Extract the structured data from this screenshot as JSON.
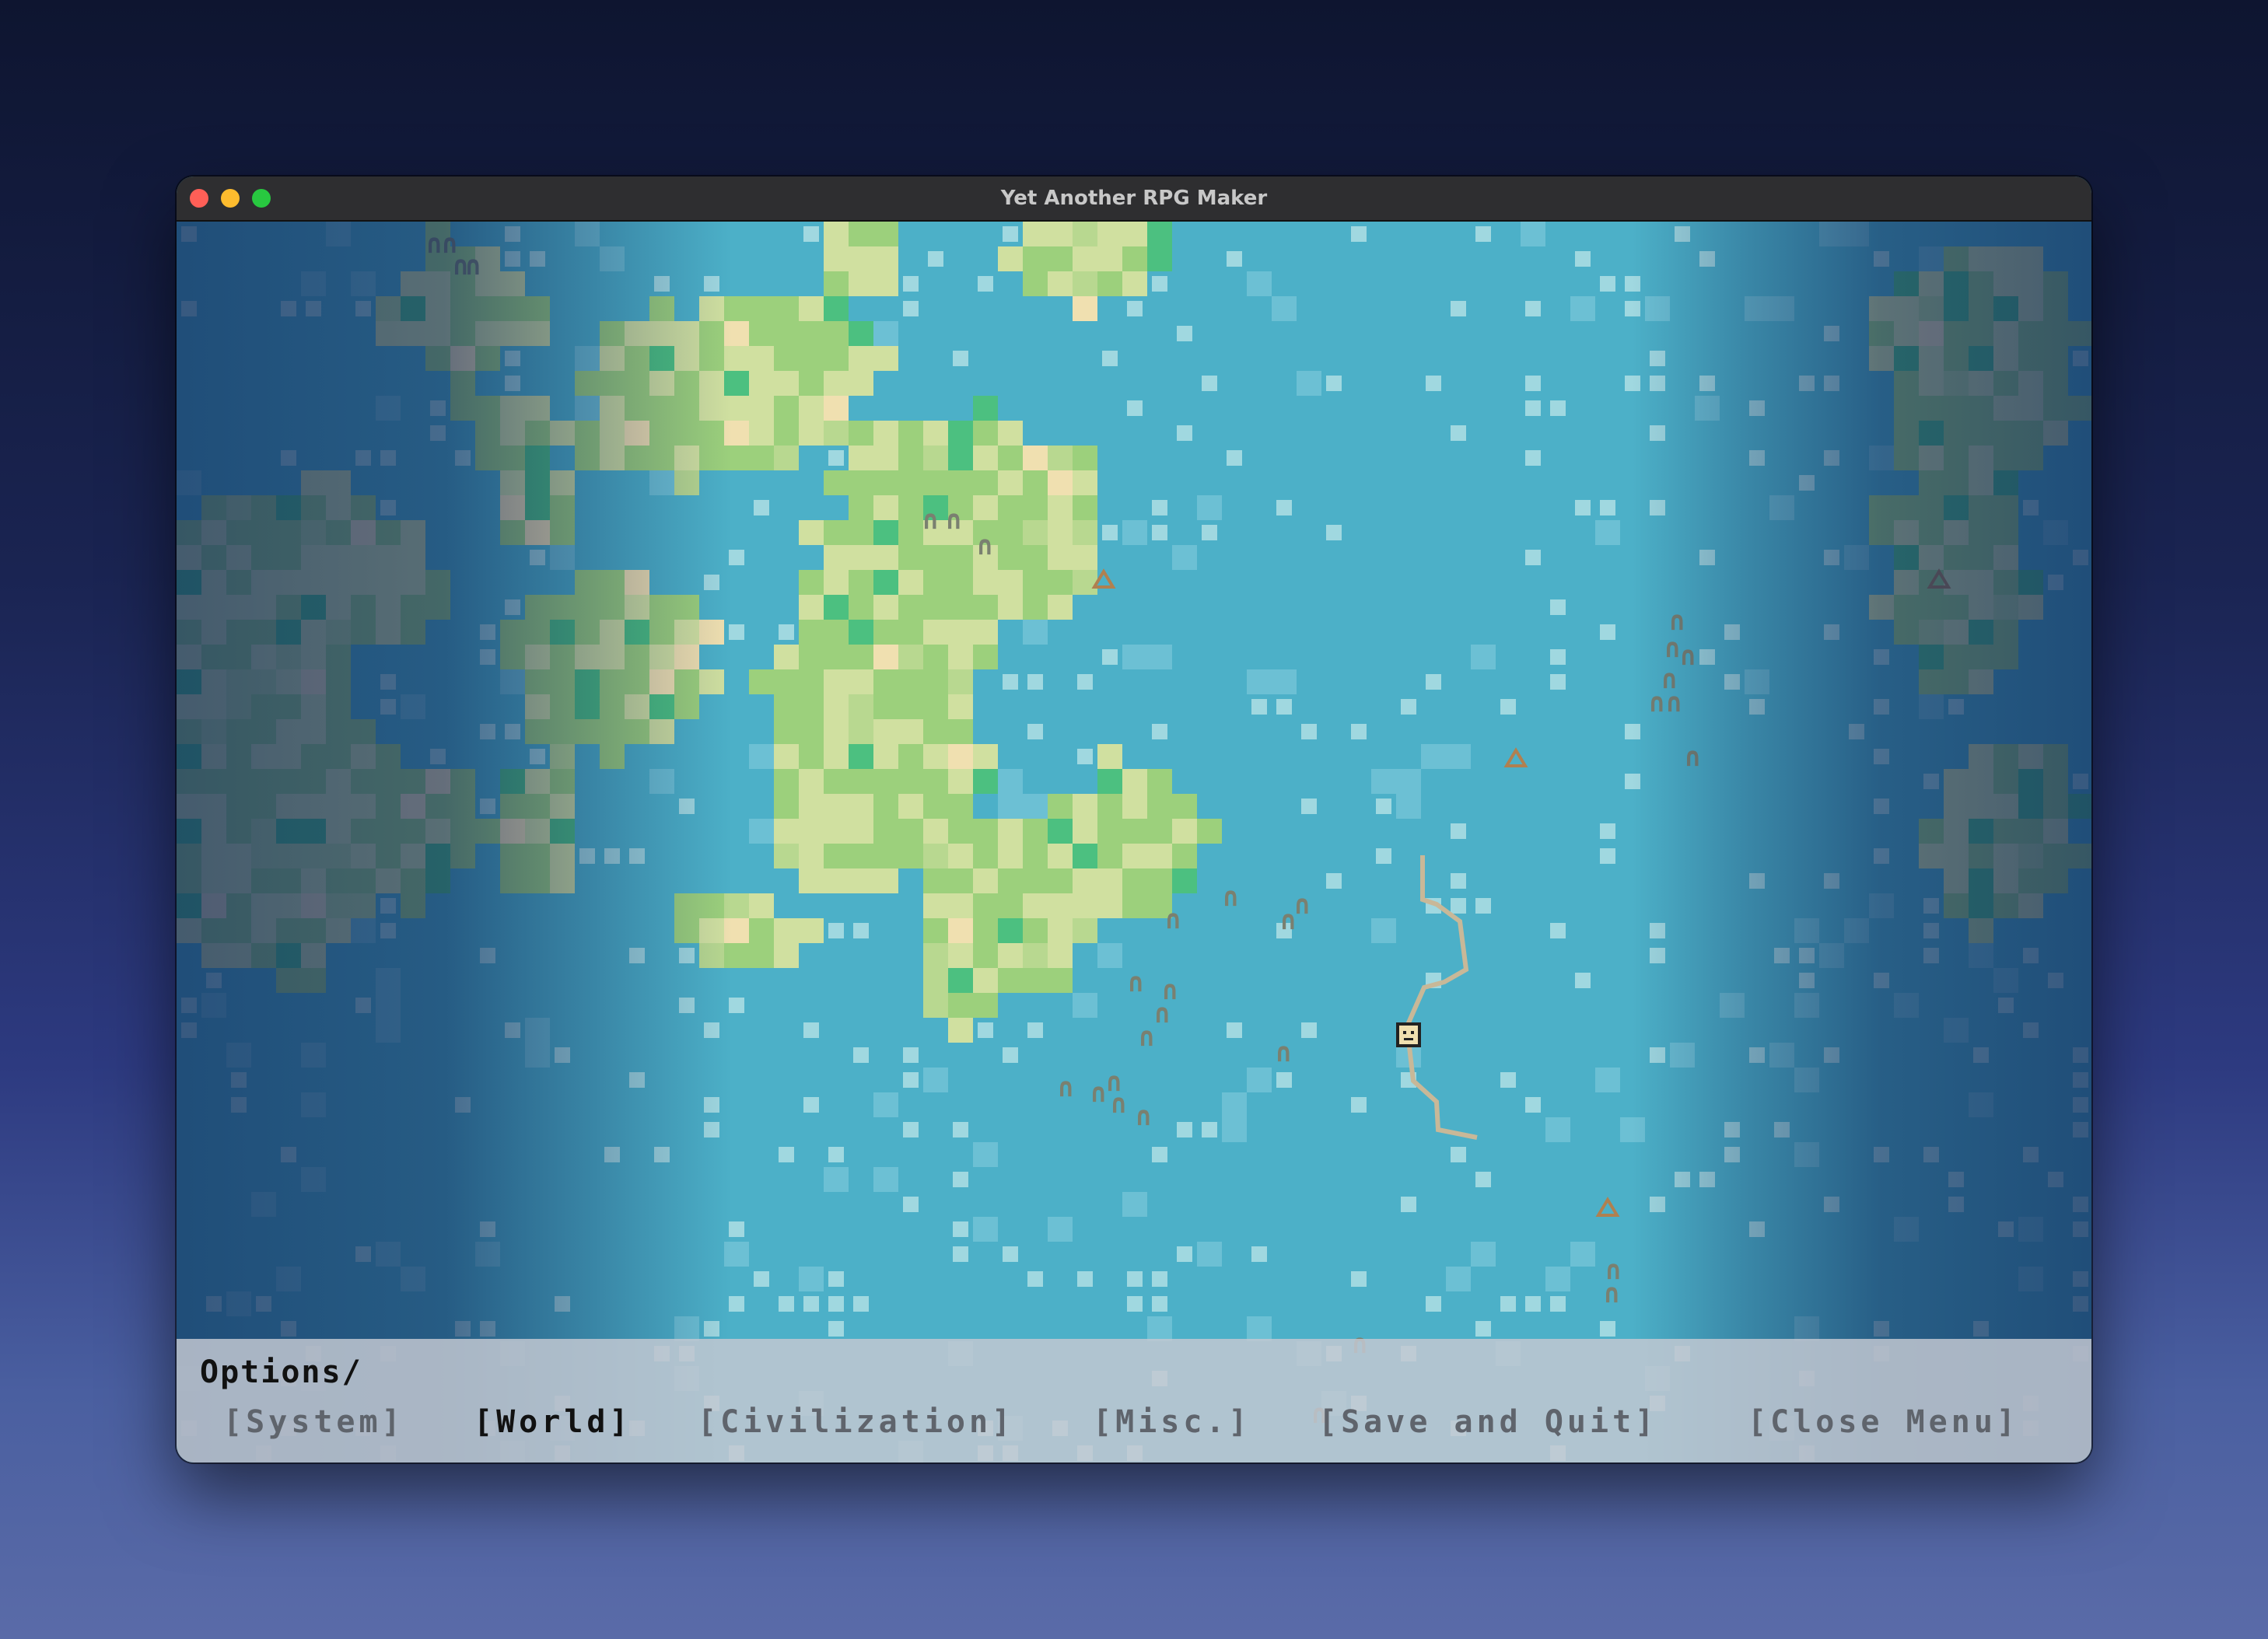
{
  "window": {
    "title": "Yet Another RPG Maker"
  },
  "menu": {
    "title": "Options/",
    "items": [
      {
        "label": "[System]",
        "active": false
      },
      {
        "label": "[World]",
        "active": true
      },
      {
        "label": "[Civilization]",
        "active": false
      },
      {
        "label": "[Misc.]",
        "active": false
      },
      {
        "label": "[Save and Quit]",
        "active": false
      },
      {
        "label": "[Close Menu]",
        "active": false
      }
    ]
  },
  "colors": {
    "ocean": "#4cb0c8",
    "shallow": "#a0d8e0",
    "grass": "#9cd07c",
    "plains": "#d0e0a0",
    "forest": "#4cc080",
    "sand": "#f0e0b0",
    "mountain": "#7a8070",
    "active_menu": "#111111",
    "inactive_menu": "#5f646c"
  },
  "icons": {
    "mountain": "arch-mountain-icon",
    "town": "triangle-town-icon",
    "player": "player-face-icon",
    "road": "dirt-road"
  }
}
